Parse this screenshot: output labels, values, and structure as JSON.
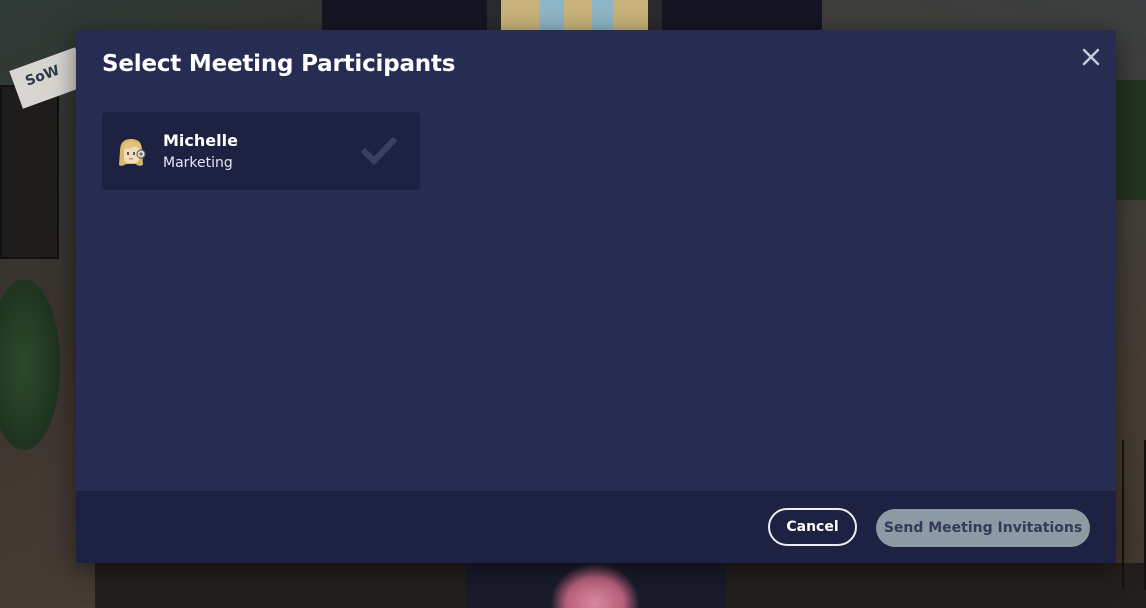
{
  "modal": {
    "title": "Select Meeting Participants",
    "close_icon": "close-icon"
  },
  "participants": [
    {
      "name": "Michelle",
      "department": "Marketing",
      "selected": true,
      "avatar_icon": "avatar",
      "check_icon": "checkmark-icon"
    }
  ],
  "footer": {
    "cancel_label": "Cancel",
    "send_label": "Send Meeting Invitations",
    "send_enabled": false
  },
  "background": {
    "sign_text": "SoW"
  },
  "colors": {
    "modal_bg": "#262c52",
    "footer_bg": "#1d2142",
    "card_bg": "#1e2242",
    "check": "#3a4062",
    "send_button_bg": "#8b9aa3",
    "send_button_text": "#343a58"
  }
}
